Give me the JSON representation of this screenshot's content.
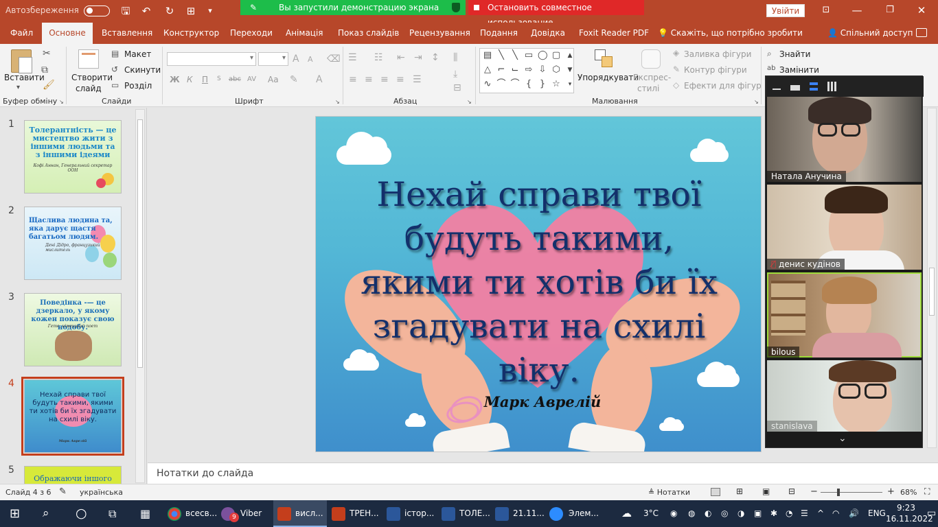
{
  "titlebar": {
    "autosave_label": "Автозбереження",
    "signin_label": "Увійти",
    "share_banner": "Вы запустили демонстрацию экрана",
    "stop_share": "Остановить совместное использование"
  },
  "tabs": {
    "items": [
      "Файл",
      "Основне",
      "Вставлення",
      "Конструктор",
      "Переходи",
      "Анімація",
      "Показ слайдів",
      "Рецензування",
      "Подання",
      "Довідка",
      "Foxit Reader PDF"
    ],
    "active": "Основне",
    "tell_me": "Скажіть, що потрібно зробити",
    "share": "Спільний доступ"
  },
  "ribbon": {
    "clipboard": {
      "paste": "Вставити",
      "label": "Буфер обміну"
    },
    "slides": {
      "new_slide_1": "Створити",
      "new_slide_2": "слайд",
      "layout": "Макет",
      "reset": "Скинути",
      "section": "Розділ",
      "label": "Слайди"
    },
    "font": {
      "bold": "Ж",
      "italic": "К",
      "underline": "П",
      "strike": "abc",
      "spacing": "AV",
      "case": "Aa",
      "label": "Шрифт"
    },
    "paragraph": {
      "label": "Абзац"
    },
    "drawing": {
      "arrange": "Упорядкувати",
      "styles_1": "Експрес-",
      "styles_2": "стилі",
      "fill": "Заливка фігури",
      "outline": "Контур фігури",
      "effects": "Ефекти для фігур",
      "label": "Малювання"
    },
    "editing": {
      "find": "Знайти",
      "replace": "Замінити"
    }
  },
  "slides_panel": {
    "thumbs": [
      {
        "num": "1",
        "text": "Толерантність — це мистецтво жити з іншими людьми та з іншими ідеями",
        "author": "Кофі Аннан, Генеральний секретар ООН"
      },
      {
        "num": "2",
        "text": "Щаслива людина та, яка дарує щастя багатьом людям.",
        "author": "Дені Дідро, французький мислитель"
      },
      {
        "num": "3",
        "text": "Поведінка -— це дзеркало, у якому кожен показує свою подобу.",
        "author": "Гете, німецький поет"
      },
      {
        "num": "4",
        "text": "Нехай справи твої будуть такими, якими ти хотів би їх згадувати на схилі віку.",
        "author": "Марк Аврелій"
      },
      {
        "num": "5",
        "text": "Ображаючи іншого"
      }
    ],
    "active": "4"
  },
  "slide": {
    "title": "Нехай справи твої будуть такими, якими ти хотів би їх згадувати на схилі віку.",
    "author": "Марк Аврелій"
  },
  "notes": {
    "placeholder": "Нотатки до слайда"
  },
  "zoom_panel": {
    "participants": [
      {
        "name": "Натала Анучина",
        "speaking": false
      },
      {
        "name": "денис кудінов",
        "muted": true
      },
      {
        "name": "bilous",
        "speaking": true
      },
      {
        "name": "stanislava",
        "speaking": false
      }
    ]
  },
  "status": {
    "slide_counter": "Слайд 4 з 6",
    "language": "українська",
    "notes": "Нотатки",
    "zoom": "68%"
  },
  "taskbar": {
    "apps": [
      "всесв...",
      "Viber",
      "висл...",
      "ТРЕН...",
      "істор...",
      "ТОЛЕ...",
      "21.11...",
      "Элем..."
    ],
    "viber_badge": "9",
    "weather": "3°C",
    "lang": "ENG",
    "time": "9:23",
    "date": "16.11.2022"
  },
  "colors": {
    "accent": "#b7472a",
    "slide_title": "#13306b",
    "share_green": "#1dbd4a",
    "stop_red": "#e02828"
  }
}
